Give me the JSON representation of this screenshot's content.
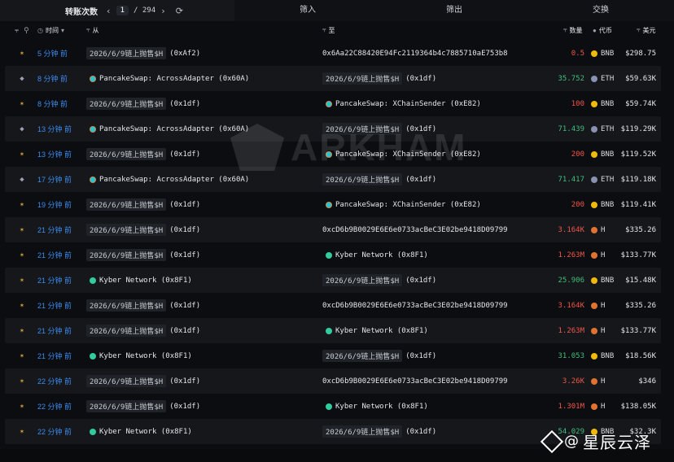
{
  "pager": {
    "label": "转账次数",
    "page": "1",
    "total": "/ 294"
  },
  "tabs": [
    "筛入",
    "筛出",
    "交换"
  ],
  "header": {
    "time": "时间",
    "from": "从",
    "to": "至",
    "qty": "数量",
    "token": "代币",
    "usd": "美元"
  },
  "watermark": "ARKHAM",
  "brand": {
    "at": "@",
    "name": "星辰云泽"
  },
  "colors": {
    "time_blue": "#3d8cf0",
    "out_red": "#f0564a",
    "in_green": "#3fbf7a",
    "bnb": "#f0b90b"
  },
  "rows": [
    {
      "dir": "bnb",
      "time": "5 分钟 前",
      "from": {
        "kind": "tag",
        "text": "2026/6/9链上抛售$H",
        "addr": "(0xAf2)"
      },
      "to": {
        "kind": "plain",
        "text": "0x6Aa22C88420E94Fc2119364b4c7885710aE753b8"
      },
      "qty": "0.5",
      "qc": "red",
      "token": "BNB",
      "coin": "bnb",
      "usd": "$298.75"
    },
    {
      "dir": "eth",
      "time": "8 分钟 前",
      "from": {
        "kind": "entity",
        "coin": "pcs",
        "text": "PancakeSwap: AcrossAdapter (0x60A)"
      },
      "to": {
        "kind": "tag",
        "text": "2026/6/9链上抛售$H",
        "addr": "(0x1df)"
      },
      "qty": "35.752",
      "qc": "green",
      "token": "ETH",
      "coin": "eth",
      "usd": "$59.63K"
    },
    {
      "dir": "bnb",
      "time": "8 分钟 前",
      "from": {
        "kind": "tag",
        "text": "2026/6/9链上抛售$H",
        "addr": "(0x1df)"
      },
      "to": {
        "kind": "entity",
        "coin": "pcs",
        "text": "PancakeSwap: XChainSender (0xE82)"
      },
      "qty": "100",
      "qc": "red",
      "token": "BNB",
      "coin": "bnb",
      "usd": "$59.74K"
    },
    {
      "dir": "eth",
      "time": "13 分钟 前",
      "from": {
        "kind": "entity",
        "coin": "pcs",
        "text": "PancakeSwap: AcrossAdapter (0x60A)"
      },
      "to": {
        "kind": "tag",
        "text": "2026/6/9链上抛售$H",
        "addr": "(0x1df)"
      },
      "qty": "71.439",
      "qc": "green",
      "token": "ETH",
      "coin": "eth",
      "usd": "$119.29K"
    },
    {
      "dir": "bnb",
      "time": "13 分钟 前",
      "from": {
        "kind": "tag",
        "text": "2026/6/9链上抛售$H",
        "addr": "(0x1df)"
      },
      "to": {
        "kind": "entity",
        "coin": "pcs",
        "text": "PancakeSwap: XChainSender (0xE82)"
      },
      "qty": "200",
      "qc": "red",
      "token": "BNB",
      "coin": "bnb",
      "usd": "$119.52K"
    },
    {
      "dir": "eth",
      "time": "17 分钟 前",
      "from": {
        "kind": "entity",
        "coin": "pcs",
        "text": "PancakeSwap: AcrossAdapter (0x60A)"
      },
      "to": {
        "kind": "tag",
        "text": "2026/6/9链上抛售$H",
        "addr": "(0x1df)"
      },
      "qty": "71.417",
      "qc": "green",
      "token": "ETH",
      "coin": "eth",
      "usd": "$119.18K"
    },
    {
      "dir": "bnb",
      "time": "19 分钟 前",
      "from": {
        "kind": "tag",
        "text": "2026/6/9链上抛售$H",
        "addr": "(0x1df)"
      },
      "to": {
        "kind": "entity",
        "coin": "pcs",
        "text": "PancakeSwap: XChainSender (0xE82)"
      },
      "qty": "200",
      "qc": "red",
      "token": "BNB",
      "coin": "bnb",
      "usd": "$119.41K"
    },
    {
      "dir": "bnb",
      "time": "21 分钟 前",
      "from": {
        "kind": "tag",
        "text": "2026/6/9链上抛售$H",
        "addr": "(0x1df)"
      },
      "to": {
        "kind": "plain",
        "text": "0xcD6b9B0029E6E6e0733acBeC3E02be9418D09799"
      },
      "qty": "3.164K",
      "qc": "red",
      "token": "H",
      "coin": "h",
      "usd": "$335.26"
    },
    {
      "dir": "bnb",
      "time": "21 分钟 前",
      "from": {
        "kind": "tag",
        "text": "2026/6/9链上抛售$H",
        "addr": "(0x1df)"
      },
      "to": {
        "kind": "entity",
        "coin": "kyber",
        "text": "Kyber Network (0x8F1)"
      },
      "qty": "1.263M",
      "qc": "red",
      "token": "H",
      "coin": "h",
      "usd": "$133.77K"
    },
    {
      "dir": "bnb",
      "time": "21 分钟 前",
      "from": {
        "kind": "entity",
        "coin": "kyber",
        "text": "Kyber Network (0x8F1)"
      },
      "to": {
        "kind": "tag",
        "text": "2026/6/9链上抛售$H",
        "addr": "(0x1df)"
      },
      "qty": "25.906",
      "qc": "green",
      "token": "BNB",
      "coin": "bnb",
      "usd": "$15.48K"
    },
    {
      "dir": "bnb",
      "time": "21 分钟 前",
      "from": {
        "kind": "tag",
        "text": "2026/6/9链上抛售$H",
        "addr": "(0x1df)"
      },
      "to": {
        "kind": "plain",
        "text": "0xcD6b9B0029E6E6e0733acBeC3E02be9418D09799"
      },
      "qty": "3.164K",
      "qc": "red",
      "token": "H",
      "coin": "h",
      "usd": "$335.26"
    },
    {
      "dir": "bnb",
      "time": "21 分钟 前",
      "from": {
        "kind": "tag",
        "text": "2026/6/9链上抛售$H",
        "addr": "(0x1df)"
      },
      "to": {
        "kind": "entity",
        "coin": "kyber",
        "text": "Kyber Network (0x8F1)"
      },
      "qty": "1.263M",
      "qc": "red",
      "token": "H",
      "coin": "h",
      "usd": "$133.77K"
    },
    {
      "dir": "bnb",
      "time": "21 分钟 前",
      "from": {
        "kind": "entity",
        "coin": "kyber",
        "text": "Kyber Network (0x8F1)"
      },
      "to": {
        "kind": "tag",
        "text": "2026/6/9链上抛售$H",
        "addr": "(0x1df)"
      },
      "qty": "31.053",
      "qc": "green",
      "token": "BNB",
      "coin": "bnb",
      "usd": "$18.56K"
    },
    {
      "dir": "bnb",
      "time": "22 分钟 前",
      "from": {
        "kind": "tag",
        "text": "2026/6/9链上抛售$H",
        "addr": "(0x1df)"
      },
      "to": {
        "kind": "plain",
        "text": "0xcD6b9B0029E6E6e0733acBeC3E02be9418D09799"
      },
      "qty": "3.26K",
      "qc": "red",
      "token": "H",
      "coin": "h",
      "usd": "$346"
    },
    {
      "dir": "bnb",
      "time": "22 分钟 前",
      "from": {
        "kind": "tag",
        "text": "2026/6/9链上抛售$H",
        "addr": "(0x1df)"
      },
      "to": {
        "kind": "entity",
        "coin": "kyber",
        "text": "Kyber Network (0x8F1)"
      },
      "qty": "1.301M",
      "qc": "red",
      "token": "H",
      "coin": "h",
      "usd": "$138.05K"
    },
    {
      "dir": "bnb",
      "time": "22 分钟 前",
      "from": {
        "kind": "entity",
        "coin": "kyber",
        "text": "Kyber Network (0x8F1)"
      },
      "to": {
        "kind": "tag",
        "text": "2026/6/9链上抛售$H",
        "addr": "(0x1df)"
      },
      "qty": "54.029",
      "qc": "green",
      "token": "BNB",
      "coin": "bnb",
      "usd": "$32.3K"
    }
  ]
}
